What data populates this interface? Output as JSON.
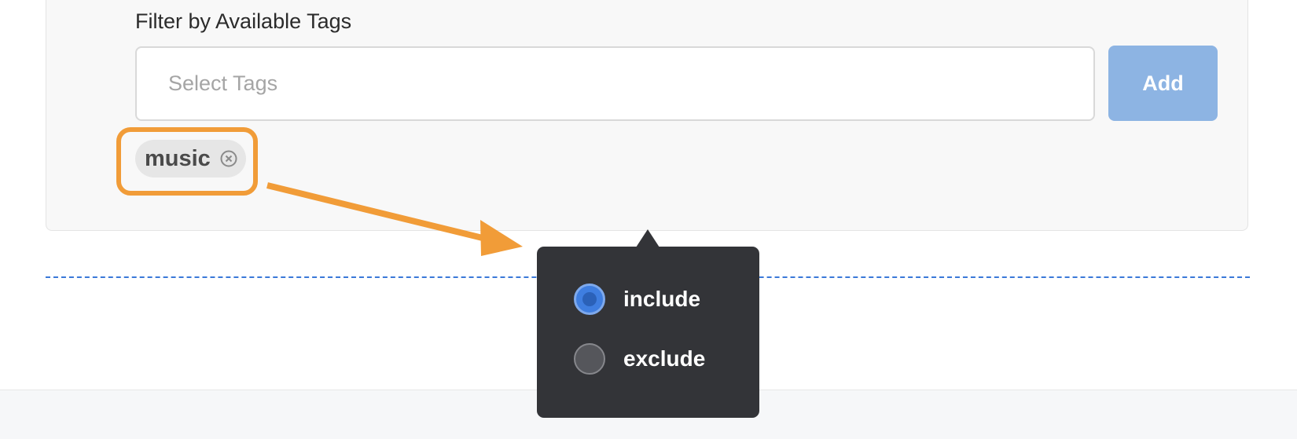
{
  "filter": {
    "label": "Filter by Available Tags",
    "input_placeholder": "Select Tags",
    "input_value": "",
    "add_label": "Add"
  },
  "tags": [
    {
      "label": "music",
      "remove_icon": "close-circle-icon"
    }
  ],
  "popover": {
    "options": [
      {
        "label": "include",
        "checked": true
      },
      {
        "label": "exclude",
        "checked": false
      }
    ]
  },
  "colors": {
    "annotation": "#f19c38",
    "add_button": "#8db4e3",
    "popover_bg": "#333438",
    "radio_active": "#3f7ee0",
    "divider": "#3a78d8"
  }
}
